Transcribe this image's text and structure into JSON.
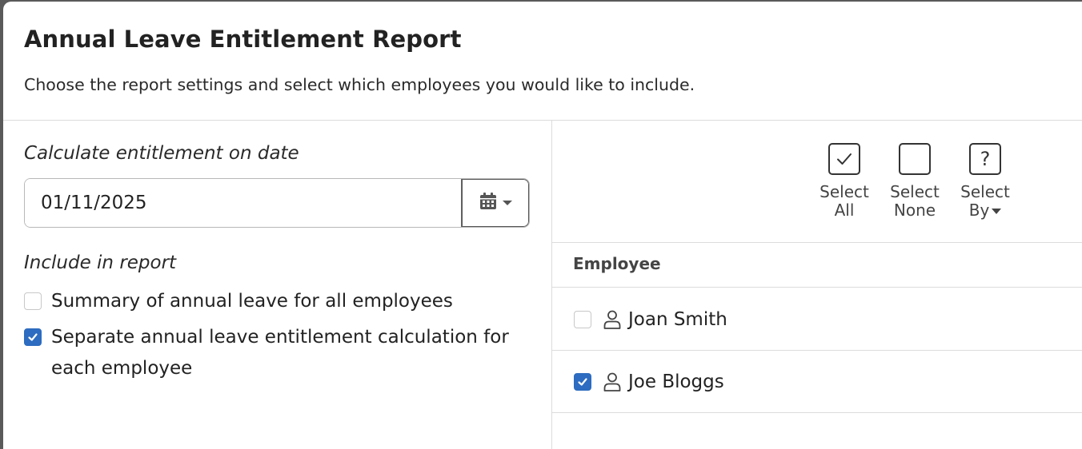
{
  "dialog": {
    "title": "Annual Leave Entitlement Report",
    "subtitle": "Choose the report settings and select which employees you would like to include."
  },
  "settings": {
    "date_label": "Calculate entitlement on date",
    "date_value": "01/11/2025",
    "date_picker_icon": "calendar-icon",
    "include_label": "Include in report",
    "options": [
      {
        "label": "Summary of annual leave for all employees",
        "checked": false
      },
      {
        "label": "Separate annual leave entitlement calculation for each employee",
        "checked": true
      }
    ]
  },
  "toolbar": {
    "select_all": {
      "line1": "Select",
      "line2": "All",
      "icon": "checkmark-icon"
    },
    "select_none": {
      "line1": "Select",
      "line2": "None",
      "icon": "empty-box-icon"
    },
    "select_by": {
      "line1": "Select",
      "line2": "By",
      "icon": "question-icon"
    }
  },
  "employees": {
    "column_title": "Employee",
    "rows": [
      {
        "name": "Joan Smith",
        "checked": false,
        "icon": "person-icon"
      },
      {
        "name": "Joe Bloggs",
        "checked": true,
        "icon": "person-icon"
      }
    ]
  },
  "colors": {
    "accent": "#2d6cc0",
    "border": "#dcdcdc"
  }
}
